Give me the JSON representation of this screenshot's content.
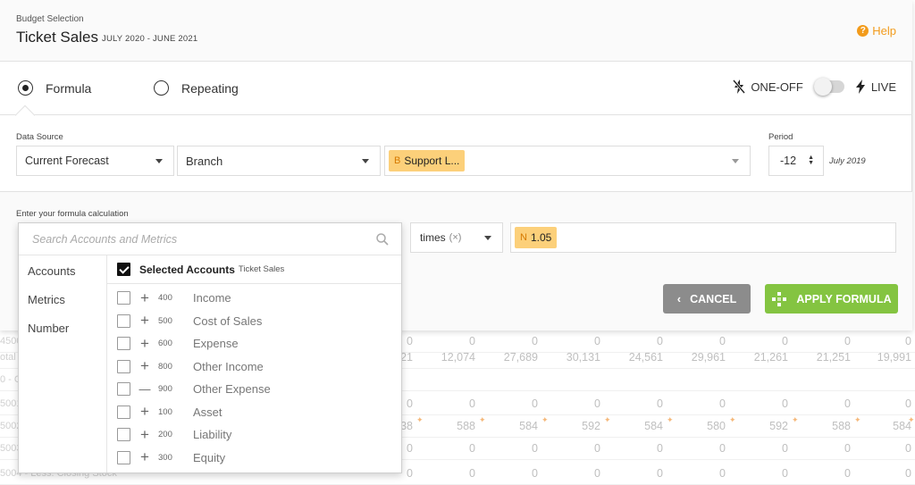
{
  "header": {
    "breadcrumb": "Budget Selection",
    "title": "Ticket Sales",
    "subtitle": "JULY 2020 - JUNE 2021",
    "help_label": "Help"
  },
  "mode": {
    "formula_label": "Formula",
    "repeating_label": "Repeating",
    "selected": "Formula",
    "one_off_label": "ONE-OFF",
    "live_label": "LIVE"
  },
  "data_source": {
    "label": "Data Source",
    "source_value": "Current Forecast",
    "dimension_value": "Branch",
    "chip_letter": "B",
    "chip_label": "Support L...",
    "period_label": "Period",
    "period_value": "-12",
    "period_date": "July 2019"
  },
  "formula": {
    "label": "Enter your formula calculation",
    "operator_label": "times",
    "operator_symbol": "(×)",
    "chip_letter": "N",
    "chip_value": "1.05",
    "cancel_label": "CANCEL",
    "apply_label": "APPLY FORMULA"
  },
  "picker": {
    "search_placeholder": "Search Accounts and Metrics",
    "categories": [
      "Accounts",
      "Metrics",
      "Number"
    ],
    "selected_title": "Selected Accounts",
    "selected_sub": "Ticket Sales",
    "accounts": [
      {
        "sign": "+",
        "code": "400",
        "name": "Income"
      },
      {
        "sign": "+",
        "code": "500",
        "name": "Cost of Sales"
      },
      {
        "sign": "+",
        "code": "600",
        "name": "Expense"
      },
      {
        "sign": "+",
        "code": "800",
        "name": "Other Income"
      },
      {
        "sign": "—",
        "code": "900",
        "name": "Other Expense"
      },
      {
        "sign": "+",
        "code": "100",
        "name": "Asset"
      },
      {
        "sign": "+",
        "code": "200",
        "name": "Liability"
      },
      {
        "sign": "+",
        "code": "300",
        "name": "Equity"
      }
    ]
  },
  "background_grid": {
    "row_labels": [
      "4500",
      "otal",
      "0 - C",
      "5001",
      "5002",
      "5003",
      "5004 - Less: Closing Stock"
    ],
    "total_values": [
      "21",
      "12,074",
      "27,689",
      "30,131",
      "24,561",
      "29,961",
      "21,261",
      "21,251",
      "19,991"
    ],
    "zero_values": [
      "0",
      "0",
      "0",
      "0",
      "0",
      "0",
      "0",
      "0",
      "0"
    ],
    "row_5002_values": [
      "38",
      "588",
      "584",
      "592",
      "584",
      "580",
      "592",
      "588",
      "584"
    ]
  },
  "colors": {
    "accent_orange": "#f29b1b",
    "apply_green": "#84c441",
    "cancel_gray": "#8c8c8c",
    "chip_yellow": "#fcd07a"
  }
}
